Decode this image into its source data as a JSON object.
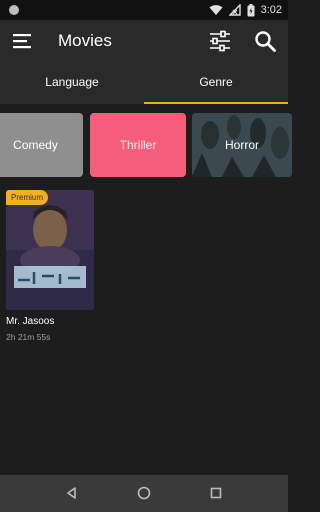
{
  "status": {
    "time": "3:02"
  },
  "app_bar": {
    "title": "Movies"
  },
  "tabs": [
    {
      "label": "Language",
      "active": false
    },
    {
      "label": "Genre",
      "active": true
    }
  ],
  "genres": [
    {
      "label": "Comedy"
    },
    {
      "label": "Thriller"
    },
    {
      "label": "Horror"
    }
  ],
  "movies": [
    {
      "badge": "Premium",
      "title": "Mr. Jasoos",
      "duration": "2h 21m 55s"
    }
  ],
  "colors": {
    "accent": "#f5a623",
    "premium": "#f2b01e",
    "thriller": "#f55e7b",
    "comedy": "#8f8f8f"
  },
  "icons": [
    "menu-icon",
    "filter-icon",
    "search-icon",
    "back-icon",
    "home-icon",
    "recents-icon"
  ]
}
